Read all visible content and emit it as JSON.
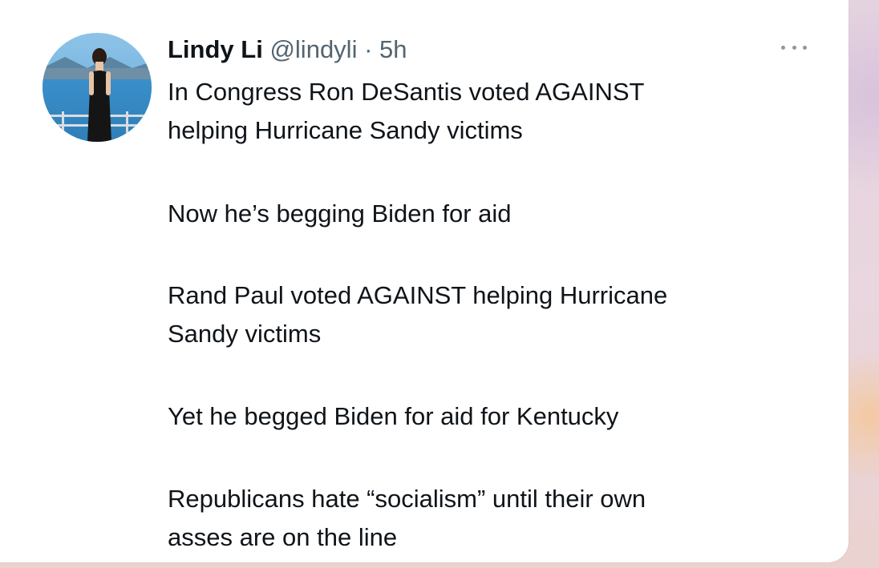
{
  "tweet": {
    "author": {
      "name": "Lindy Li",
      "handle": "@lindyli",
      "separator": "·",
      "time": "5h"
    },
    "more_icon": "more-horizontal-icon",
    "paragraphs": [
      "In Congress Ron DeSantis voted AGAINST\nhelping Hurricane Sandy victims",
      "Now he’s begging Biden for aid",
      "Rand Paul voted AGAINST helping Hurricane\nSandy victims",
      "Yet he begged Biden for aid for Kentucky",
      "Republicans hate “socialism” until their own\nasses are on the line"
    ]
  },
  "colors": {
    "text": "#0f1419",
    "secondary": "#536471",
    "card": "#ffffff"
  }
}
